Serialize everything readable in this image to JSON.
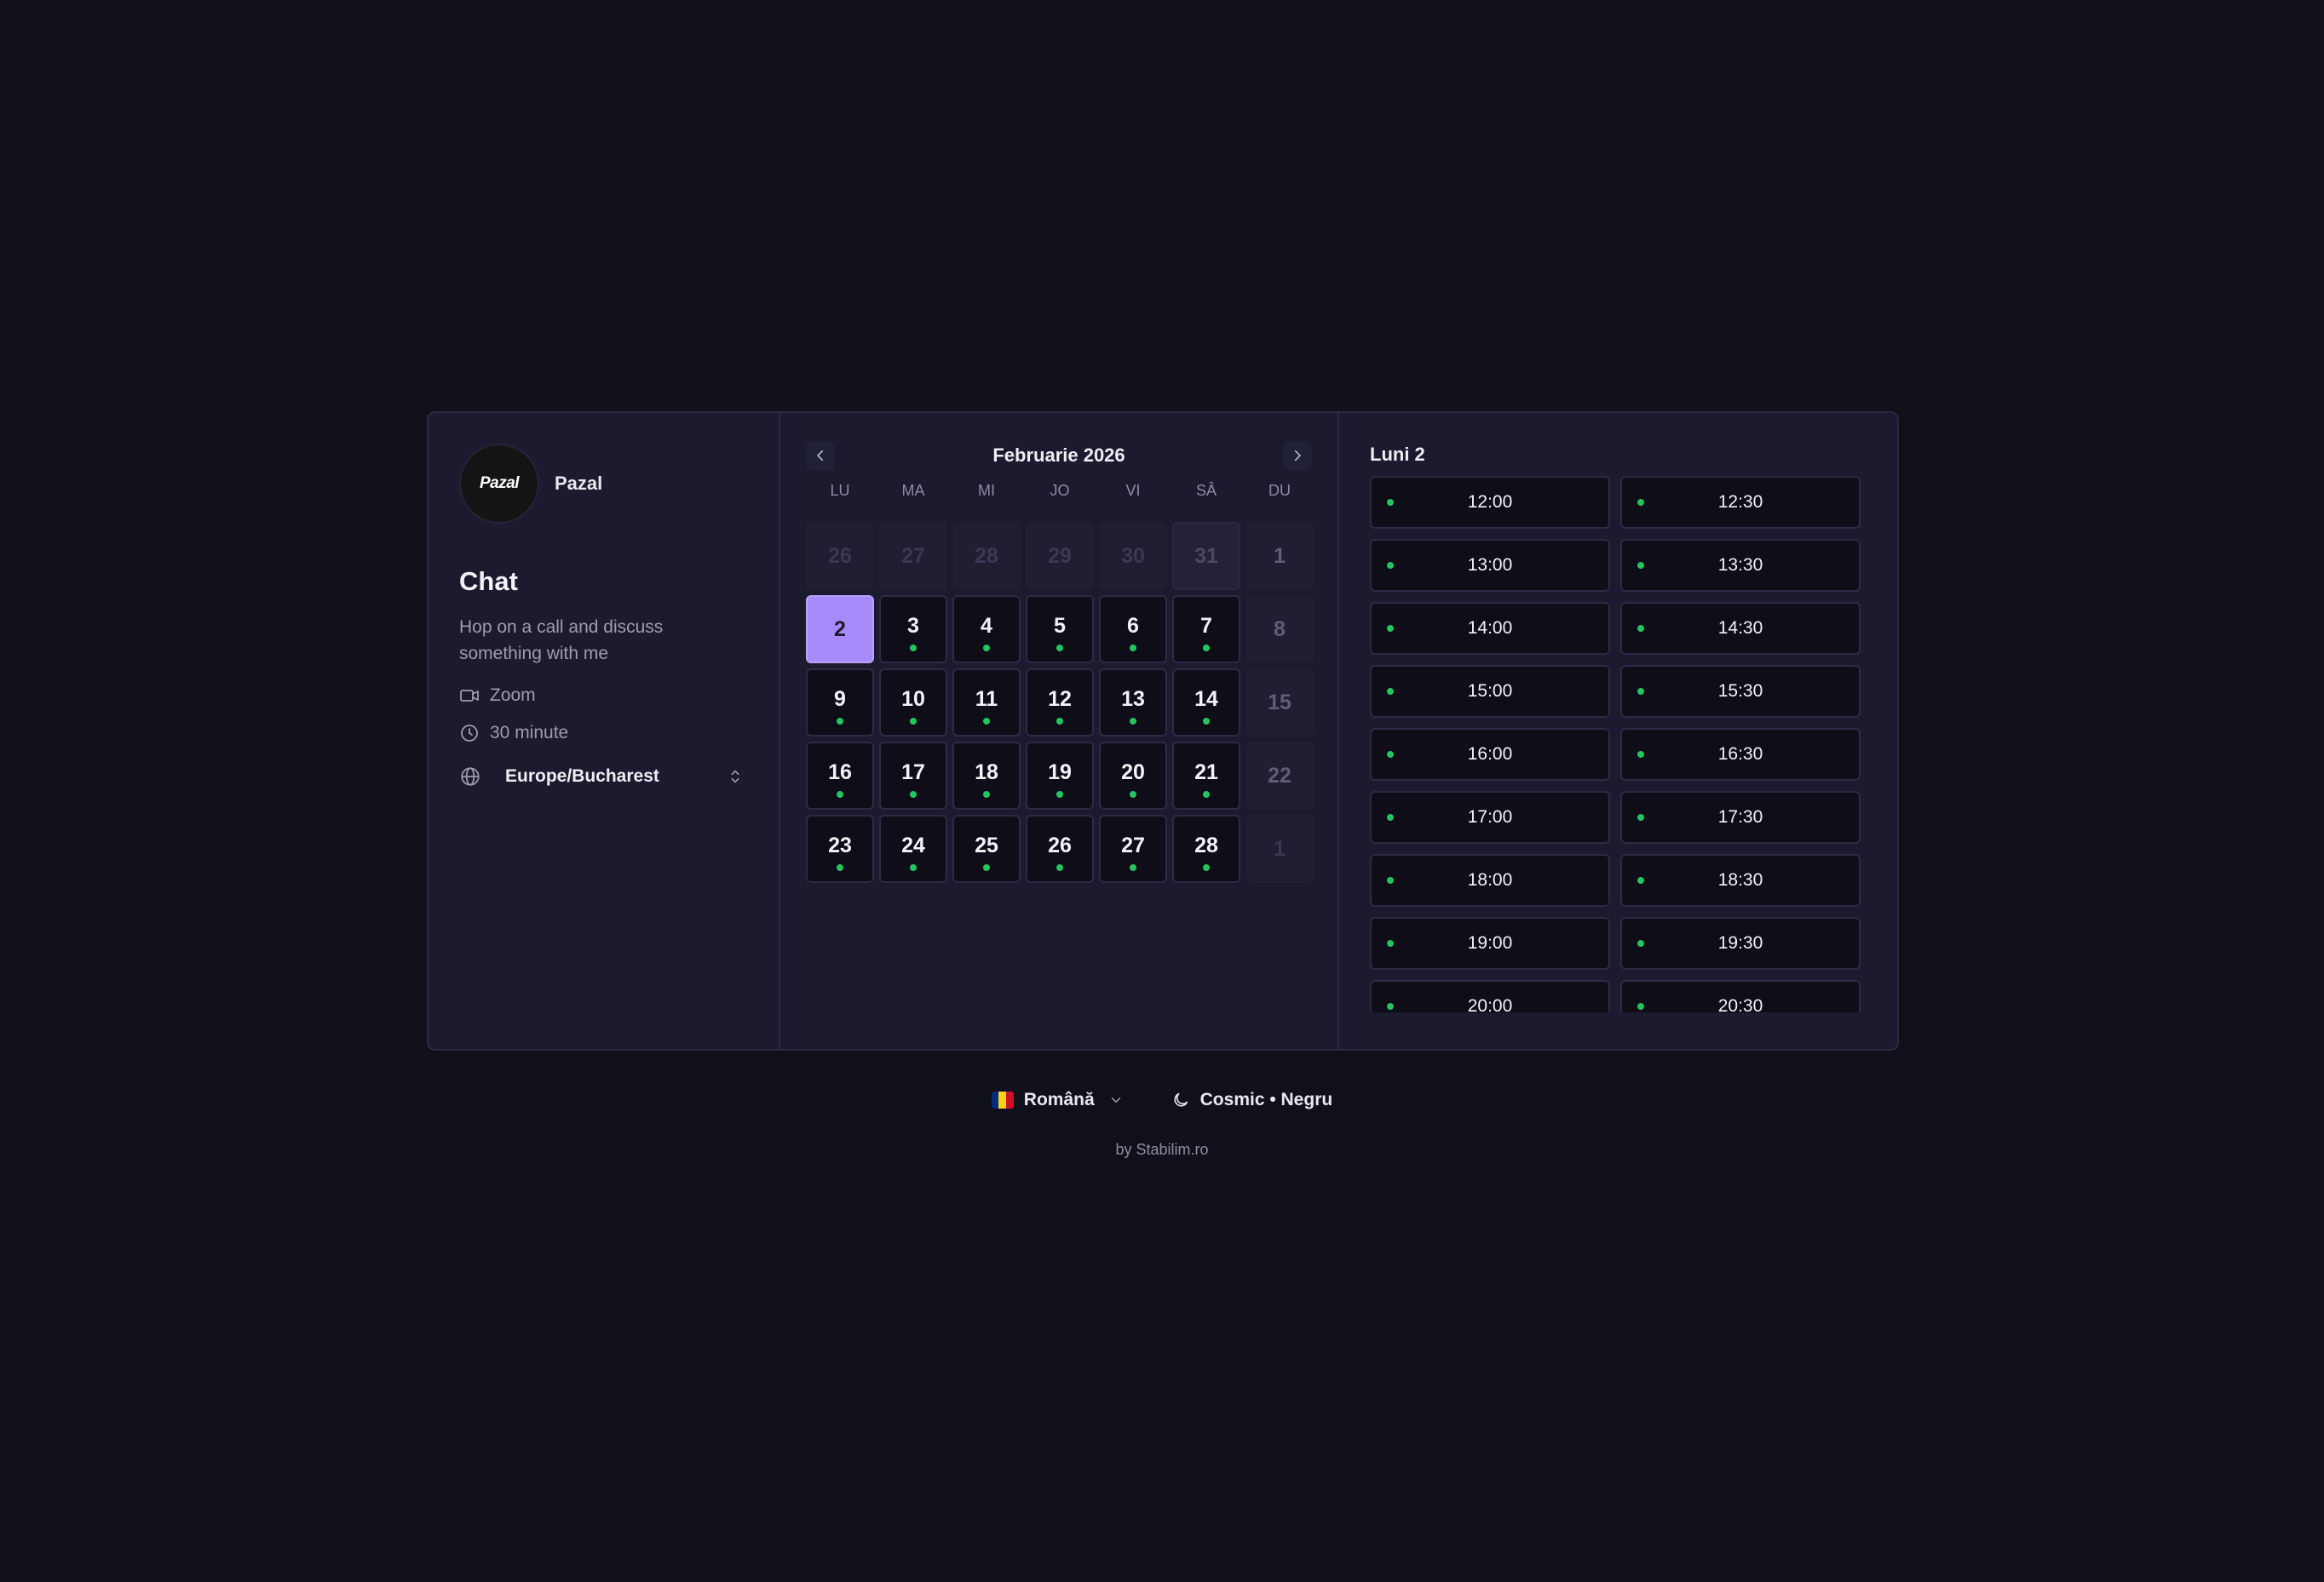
{
  "host": {
    "avatar_text": "Pazal",
    "name": "Pazal"
  },
  "event": {
    "title": "Chat",
    "description": "Hop on a call and discuss something with me",
    "location": "Zoom",
    "duration": "30 minute",
    "timezone": "Europe/Bucharest"
  },
  "calendar": {
    "month_label": "Februarie 2026",
    "weekdays": [
      "LU",
      "MA",
      "MI",
      "JO",
      "VI",
      "SÂ",
      "DU"
    ],
    "days": [
      {
        "label": "26",
        "state": "muted"
      },
      {
        "label": "27",
        "state": "muted"
      },
      {
        "label": "28",
        "state": "muted"
      },
      {
        "label": "29",
        "state": "muted"
      },
      {
        "label": "30",
        "state": "muted"
      },
      {
        "label": "31",
        "state": "muted-dark"
      },
      {
        "label": "1",
        "state": "unavail"
      },
      {
        "label": "2",
        "state": "selected"
      },
      {
        "label": "3",
        "state": "avail"
      },
      {
        "label": "4",
        "state": "avail"
      },
      {
        "label": "5",
        "state": "avail"
      },
      {
        "label": "6",
        "state": "avail"
      },
      {
        "label": "7",
        "state": "avail"
      },
      {
        "label": "8",
        "state": "unavail"
      },
      {
        "label": "9",
        "state": "avail"
      },
      {
        "label": "10",
        "state": "avail"
      },
      {
        "label": "11",
        "state": "avail"
      },
      {
        "label": "12",
        "state": "avail"
      },
      {
        "label": "13",
        "state": "avail"
      },
      {
        "label": "14",
        "state": "avail"
      },
      {
        "label": "15",
        "state": "unavail"
      },
      {
        "label": "16",
        "state": "avail"
      },
      {
        "label": "17",
        "state": "avail"
      },
      {
        "label": "18",
        "state": "avail"
      },
      {
        "label": "19",
        "state": "avail"
      },
      {
        "label": "20",
        "state": "avail"
      },
      {
        "label": "21",
        "state": "avail"
      },
      {
        "label": "22",
        "state": "unavail"
      },
      {
        "label": "23",
        "state": "avail"
      },
      {
        "label": "24",
        "state": "avail"
      },
      {
        "label": "25",
        "state": "avail"
      },
      {
        "label": "26",
        "state": "avail"
      },
      {
        "label": "27",
        "state": "avail"
      },
      {
        "label": "28",
        "state": "avail"
      },
      {
        "label": "1",
        "state": "muted"
      }
    ]
  },
  "slots": {
    "title": "Luni 2",
    "times": [
      "12:00",
      "12:30",
      "13:00",
      "13:30",
      "14:00",
      "14:30",
      "15:00",
      "15:30",
      "16:00",
      "16:30",
      "17:00",
      "17:30",
      "18:00",
      "18:30",
      "19:00",
      "19:30",
      "20:00",
      "20:30"
    ]
  },
  "footer": {
    "language": "Română",
    "theme": "Cosmic • Negru",
    "credit": "by Stabilim.ro"
  },
  "colors": {
    "background": "#10101a",
    "card": "#1b1a2e",
    "accent": "#a78bfa",
    "available_dot": "#22c55e"
  }
}
